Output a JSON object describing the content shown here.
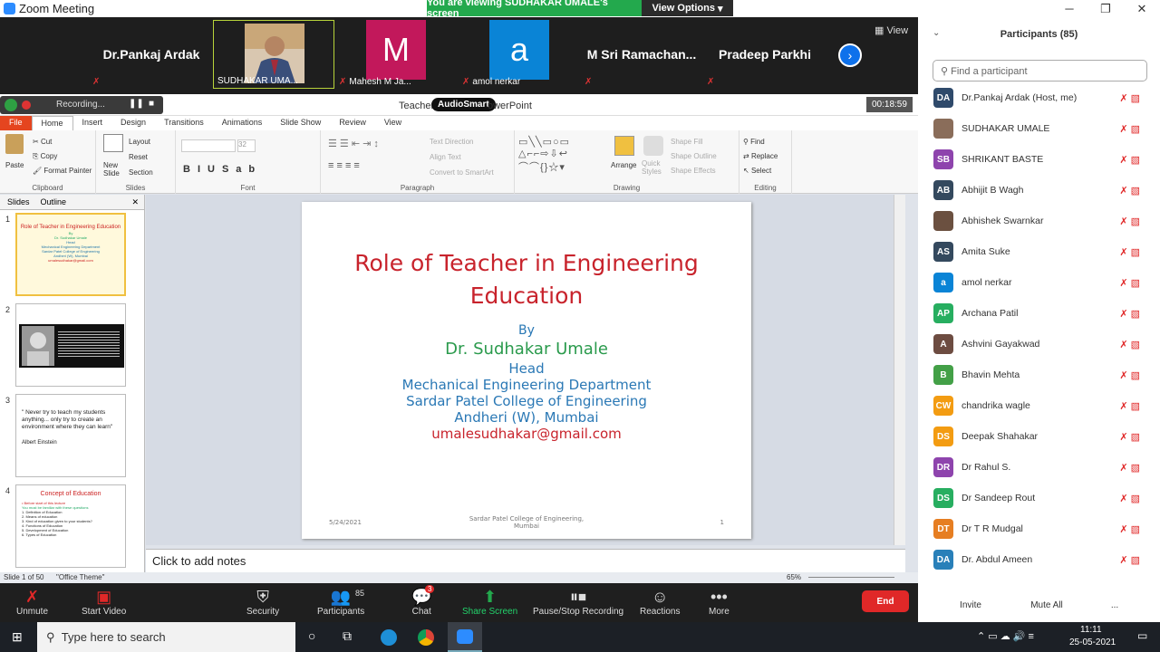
{
  "window": {
    "title": "Zoom Meeting",
    "minimize": "─",
    "restore": "❐",
    "close": "✕"
  },
  "banner": {
    "viewing": "You are viewing SUDHAKAR UMALE's screen",
    "view_options": "View Options"
  },
  "strip": {
    "tiles": [
      {
        "name": "Dr.Pankaj Ardak"
      },
      {
        "name": "SUDHAKAR UMA..."
      },
      {
        "letter": "M",
        "name": "Mahesh M Ja...",
        "color": "#c2185b"
      },
      {
        "letter": "a",
        "name": "amol nerkar",
        "color": "#0a84d6"
      },
      {
        "name": "M Sri Ramachan..."
      },
      {
        "name": "Pradeep Parkhi"
      }
    ],
    "view": "View"
  },
  "ppt": {
    "recording": "Recording...",
    "title_left": "Teacher",
    "audiosmart": "AudioSmart",
    "title_right": "owerPoint",
    "timer": "00:18:59",
    "tabs": [
      "File",
      "Home",
      "Insert",
      "Design",
      "Transitions",
      "Animations",
      "Slide Show",
      "Review",
      "View"
    ],
    "ribbon": {
      "paste": "Paste",
      "cut": "Cut",
      "copy": "Copy",
      "format_painter": "Format Painter",
      "clipboard": "Clipboard",
      "new_slide": "New Slide",
      "layout": "Layout",
      "reset": "Reset",
      "section": "Section",
      "slides": "Slides",
      "font": "Font",
      "font_size": "32",
      "paragraph": "Paragraph",
      "text_direction": "Text Direction",
      "align_text": "Align Text",
      "smartart": "Convert to SmartArt",
      "arrange": "Arrange",
      "quick_styles": "Quick Styles",
      "shape_fill": "Shape Fill",
      "shape_outline": "Shape Outline",
      "shape_effects": "Shape Effects",
      "drawing": "Drawing",
      "find": "Find",
      "replace": "Replace",
      "select": "Select",
      "editing": "Editing"
    },
    "pane_tabs": [
      "Slides",
      "Outline"
    ],
    "thumbs": [
      {
        "num": "1",
        "title": "Role of Teacher in Engineering Education",
        "lines": [
          "By",
          "Dr. Sudhakar Umale",
          "Head",
          "Mechanical Engineering Department",
          "Sardar Patel College of Engineering",
          "Andheri (W), Mumbai",
          "umalesudhakar@gmail.com"
        ]
      },
      {
        "num": "2"
      },
      {
        "num": "3",
        "quote": "\" Never try to teach my students anything... only try to create an environment where they can learn\"",
        "author": "Albert Einstein"
      },
      {
        "num": "4",
        "title": "Concept of Education",
        "lines": [
          "• Before start of this lecture",
          "You must be familiar with these questions",
          "1. Definition of Education",
          "2. Means of education",
          "3. Kind of education given to your students?",
          "4. Functions of Education",
          "5. Development of Education",
          "6. Types of Education"
        ]
      }
    ],
    "slide": {
      "title_line1": "Role of Teacher in Engineering",
      "title_line2": "Education",
      "by": "By",
      "author": "Dr. Sudhakar Umale",
      "role": "Head",
      "dept": "Mechanical Engineering Department",
      "college": "Sardar Patel College of Engineering",
      "location": "Andheri (W), Mumbai",
      "email": "umalesudhakar@gmail.com",
      "date": "5/24/2021",
      "footer_line1": "Sardar Patel College of Engineering,",
      "footer_line2": "Mumbai",
      "page": "1"
    },
    "notes": "Click to add notes",
    "status": {
      "slide": "Slide 1 of 50",
      "theme": "\"Office Theme\"",
      "zoom": "65%"
    }
  },
  "zoom_bar": {
    "unmute": "Unmute",
    "start_video": "Start Video",
    "security": "Security",
    "participants": "Participants",
    "participants_count": "85",
    "chat": "Chat",
    "chat_badge": "3",
    "share_screen": "Share Screen",
    "recording": "Pause/Stop Recording",
    "reactions": "Reactions",
    "more": "More",
    "end": "End"
  },
  "panel": {
    "title": "Participants (85)",
    "search_placeholder": "Find a participant",
    "participants": [
      {
        "initials": "DA",
        "name": "Dr.Pankaj Ardak (Host, me)",
        "color": "#2f4a6b"
      },
      {
        "initials": "",
        "name": "SUDHAKAR UMALE",
        "color": "#8a6d5a"
      },
      {
        "initials": "SB",
        "name": "SHRIKANT BASTE",
        "color": "#8e44ad"
      },
      {
        "initials": "AB",
        "name": "Abhijit B Wagh",
        "color": "#34495e"
      },
      {
        "initials": "",
        "name": "Abhishek Swarnkar",
        "color": "#6b5040"
      },
      {
        "initials": "AS",
        "name": "Amita Suke",
        "color": "#34495e"
      },
      {
        "initials": "a",
        "name": "amol nerkar",
        "color": "#0a84d6"
      },
      {
        "initials": "AP",
        "name": "Archana Patil",
        "color": "#27ae60"
      },
      {
        "initials": "A",
        "name": "Ashvini Gayakwad",
        "color": "#6d4c41"
      },
      {
        "initials": "B",
        "name": "Bhavin Mehta",
        "color": "#43a047"
      },
      {
        "initials": "CW",
        "name": "chandrika wagle",
        "color": "#f39c12"
      },
      {
        "initials": "DS",
        "name": "Deepak Shahakar",
        "color": "#f39c12"
      },
      {
        "initials": "DR",
        "name": "Dr Rahul S.",
        "color": "#8e44ad"
      },
      {
        "initials": "DS",
        "name": "Dr Sandeep Rout",
        "color": "#27ae60"
      },
      {
        "initials": "DT",
        "name": "Dr T R Mudgal",
        "color": "#e67e22"
      },
      {
        "initials": "DA",
        "name": "Dr. Abdul Ameen",
        "color": "#2980b9"
      }
    ],
    "invite": "Invite",
    "mute_all": "Mute All",
    "more": "..."
  },
  "taskbar": {
    "search": "Type here to search",
    "time": "11:11",
    "date": "25-05-2021"
  }
}
